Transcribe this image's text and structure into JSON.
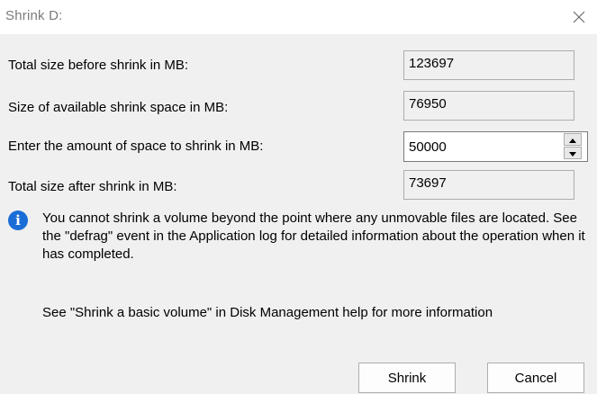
{
  "window": {
    "title": "Shrink D:",
    "close_icon": "close-icon"
  },
  "fields": {
    "total_before": {
      "label": "Total size before shrink in MB:",
      "value": "123697"
    },
    "available": {
      "label": "Size of available shrink space in MB:",
      "value": "76950"
    },
    "amount": {
      "label": "Enter the amount of space to shrink in MB:",
      "value": "50000"
    },
    "total_after": {
      "label": "Total size after shrink in MB:",
      "value": "73697"
    }
  },
  "info": {
    "icon": "info-icon",
    "icon_glyph": "i",
    "message": "You cannot shrink a volume beyond the point where any unmovable files are located. See the \"defrag\" event in the Application log for detailed information about the operation when it has completed."
  },
  "help": {
    "text": "See \"Shrink a basic volume\" in Disk Management help for more information"
  },
  "buttons": {
    "shrink": "Shrink",
    "cancel": "Cancel"
  },
  "colors": {
    "info_blue": "#1a6dd6",
    "dialog_bg": "#f0f0f0",
    "title_bg": "#ffffff"
  }
}
